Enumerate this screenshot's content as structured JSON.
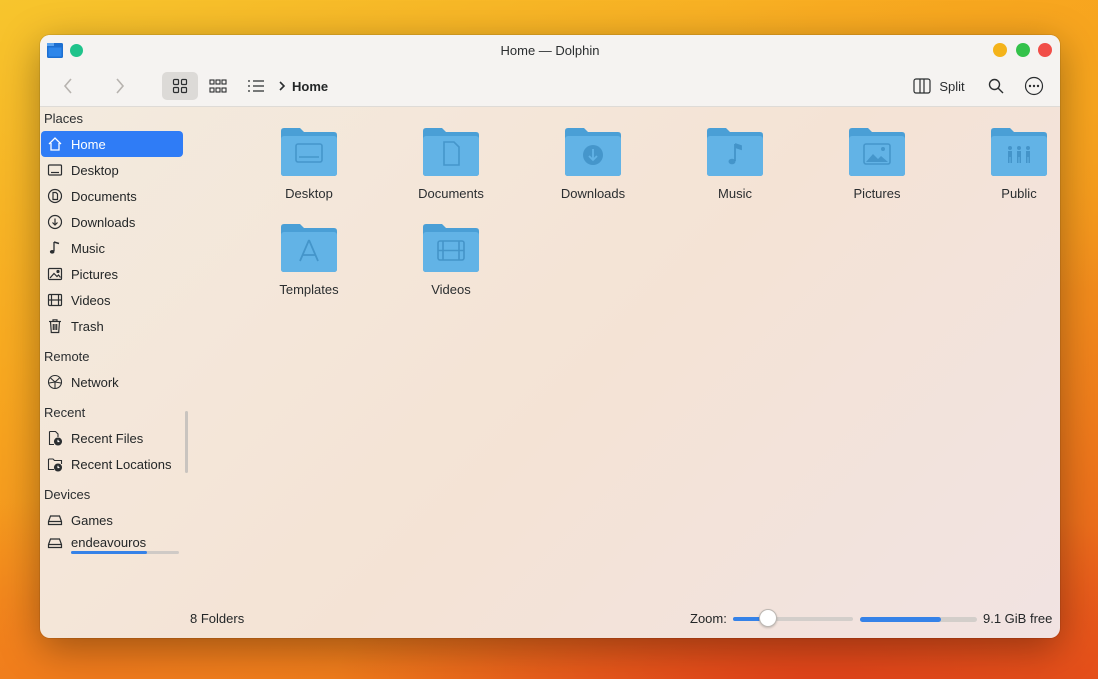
{
  "window": {
    "title": "Home — Dolphin",
    "colors": {
      "accent": "#2f7cf6",
      "folder": "#5eaee0",
      "minimize": "#f4b31a",
      "maximize": "#34c24a",
      "close": "#f14e48",
      "pin": "#1fc38b"
    }
  },
  "toolbar": {
    "breadcrumb": "Home",
    "split_label": "Split"
  },
  "sidebar": {
    "places_header": "Places",
    "places": [
      {
        "label": "Home",
        "icon": "home-icon",
        "active": true
      },
      {
        "label": "Desktop",
        "icon": "desktop-icon"
      },
      {
        "label": "Documents",
        "icon": "documents-icon"
      },
      {
        "label": "Downloads",
        "icon": "downloads-icon"
      },
      {
        "label": "Music",
        "icon": "music-icon"
      },
      {
        "label": "Pictures",
        "icon": "pictures-icon"
      },
      {
        "label": "Videos",
        "icon": "videos-icon"
      },
      {
        "label": "Trash",
        "icon": "trash-icon"
      }
    ],
    "remote_header": "Remote",
    "remote": [
      {
        "label": "Network",
        "icon": "network-icon"
      }
    ],
    "recent_header": "Recent",
    "recent": [
      {
        "label": "Recent Files",
        "icon": "recent-files-icon"
      },
      {
        "label": "Recent Locations",
        "icon": "recent-locations-icon"
      }
    ],
    "devices_header": "Devices",
    "devices": [
      {
        "label": "Games",
        "icon": "drive-icon"
      },
      {
        "label": "endeavouros",
        "icon": "drive-icon",
        "usage_fraction": 0.7
      }
    ]
  },
  "content": {
    "folders": [
      {
        "label": "Desktop",
        "emblem": "desktop"
      },
      {
        "label": "Documents",
        "emblem": "document"
      },
      {
        "label": "Downloads",
        "emblem": "download"
      },
      {
        "label": "Music",
        "emblem": "music"
      },
      {
        "label": "Pictures",
        "emblem": "picture"
      },
      {
        "label": "Public",
        "emblem": "people"
      },
      {
        "label": "Templates",
        "emblem": "template"
      },
      {
        "label": "Videos",
        "emblem": "video"
      }
    ]
  },
  "statusbar": {
    "summary": "8 Folders",
    "zoom_label": "Zoom:",
    "zoom_fraction": 0.29,
    "free_space": "9.1 GiB free",
    "used_fraction": 0.69
  }
}
